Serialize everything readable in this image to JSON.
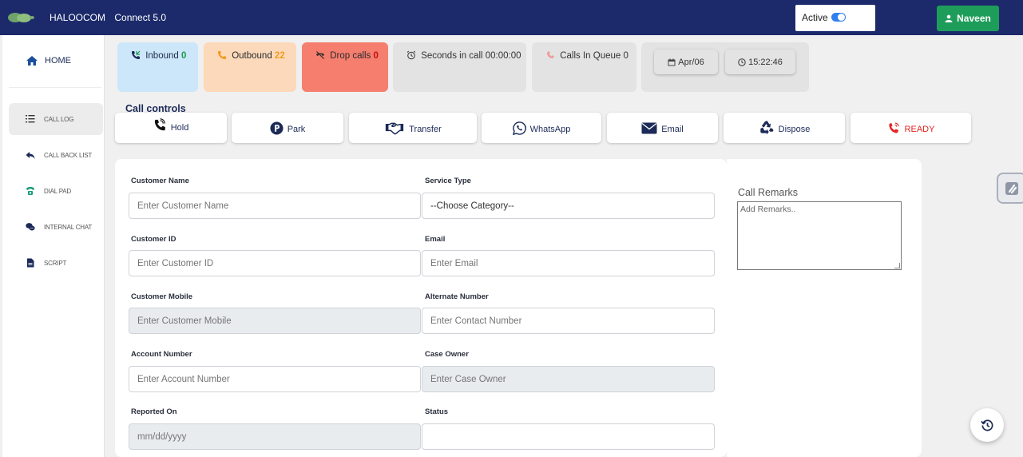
{
  "app": {
    "name": "HALOOCOM",
    "version": "Connect 5.0"
  },
  "header": {
    "status_label": "Active",
    "status_on": true,
    "user_name": "Naveen"
  },
  "sidebar": {
    "home": "HOME",
    "items": [
      {
        "label": "CALL LOG",
        "icon": "list-icon",
        "selected": true
      },
      {
        "label": "CALL BACK LIST",
        "icon": "reply-icon",
        "selected": false
      },
      {
        "label": "DIAL PAD",
        "icon": "phone-icon",
        "selected": false
      },
      {
        "label": "INTERNAL CHAT",
        "icon": "chat-icon",
        "selected": false
      },
      {
        "label": "SCRIPT",
        "icon": "document-icon",
        "selected": false
      }
    ]
  },
  "stats": {
    "inbound": {
      "label": "Inbound",
      "value": "0"
    },
    "outbound": {
      "label": "Outbound",
      "value": "22"
    },
    "drop": {
      "label": "Drop calls",
      "value": "0"
    },
    "seconds": {
      "label": "Seconds in call 00:00:00"
    },
    "queue": {
      "label": "Calls In Queue 0"
    },
    "date": "Apr/06",
    "time": "15:22:46"
  },
  "call_controls": {
    "title": "Call controls",
    "buttons": {
      "hold": "Hold",
      "park": "Park",
      "transfer": "Transfer",
      "whatsapp": "WhatsApp",
      "email": "Email",
      "dispose": "Dispose",
      "ready": "READY"
    }
  },
  "form": {
    "customer_name": {
      "label": "Customer Name",
      "placeholder": "Enter Customer Name"
    },
    "service_type": {
      "label": "Service Type",
      "value": "--Choose Category--"
    },
    "customer_id": {
      "label": "Customer ID",
      "placeholder": "Enter Customer ID"
    },
    "email": {
      "label": "Email",
      "placeholder": "Enter Email"
    },
    "customer_mobile": {
      "label": "Customer Mobile",
      "placeholder": "Enter Customer Mobile"
    },
    "alternate_number": {
      "label": "Alternate Number",
      "placeholder": "Enter Contact Number"
    },
    "account_number": {
      "label": "Account Number",
      "placeholder": "Enter Account Number"
    },
    "case_owner": {
      "label": "Case Owner",
      "placeholder": "Enter Case Owner"
    },
    "reported_on": {
      "label": "Reported On",
      "placeholder": "mm/dd/yyyy"
    },
    "status": {
      "label": "Status",
      "value": ""
    }
  },
  "remarks": {
    "label": "Call Remarks",
    "placeholder": "Add Remarks.."
  },
  "colors": {
    "topbar": "#1c2a6b",
    "user_button": "#1e9d5a",
    "inbound_bg": "#cce6fa",
    "outbound_bg": "#fcd9bb",
    "drop_bg": "#f57e6e",
    "ready": "#e32424"
  }
}
